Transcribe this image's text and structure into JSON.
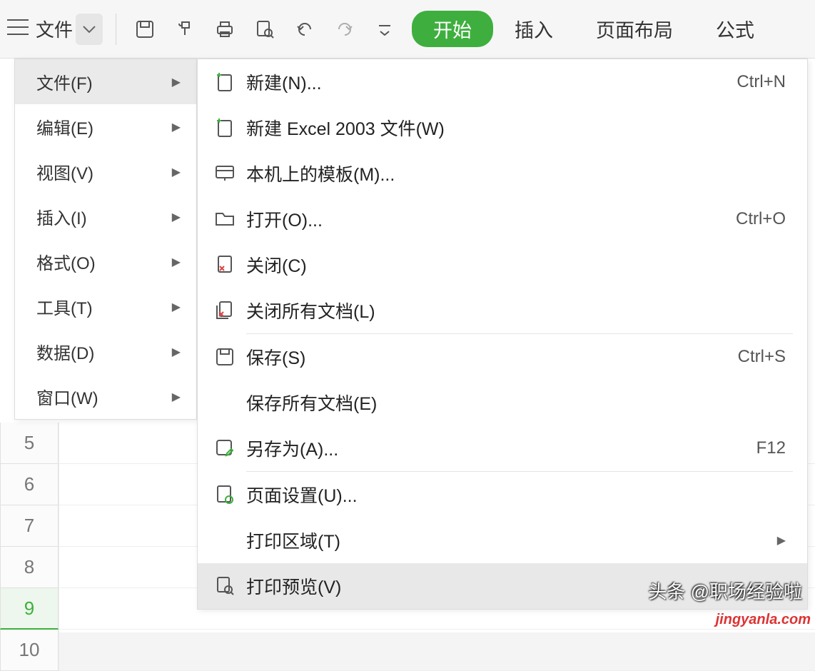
{
  "toolbar": {
    "file_label": "文件",
    "tabs": {
      "start": "开始",
      "insert": "插入",
      "page_layout": "页面布局",
      "formula": "公式"
    }
  },
  "left_menu": [
    {
      "label": "文件(F)"
    },
    {
      "label": "编辑(E)"
    },
    {
      "label": "视图(V)"
    },
    {
      "label": "插入(I)"
    },
    {
      "label": "格式(O)"
    },
    {
      "label": "工具(T)"
    },
    {
      "label": "数据(D)"
    },
    {
      "label": "窗口(W)"
    }
  ],
  "right_menu": {
    "new": {
      "label": "新建(N)...",
      "shortcut": "Ctrl+N"
    },
    "new_excel2003": {
      "label": "新建 Excel 2003 文件(W)"
    },
    "templates": {
      "label": "本机上的模板(M)..."
    },
    "open": {
      "label": "打开(O)...",
      "shortcut": "Ctrl+O"
    },
    "close": {
      "label": "关闭(C)"
    },
    "close_all": {
      "label": "关闭所有文档(L)"
    },
    "save": {
      "label": "保存(S)",
      "shortcut": "Ctrl+S"
    },
    "save_all": {
      "label": "保存所有文档(E)"
    },
    "save_as": {
      "label": "另存为(A)...",
      "shortcut": "F12"
    },
    "page_setup": {
      "label": "页面设置(U)..."
    },
    "print_area": {
      "label": "打印区域(T)"
    },
    "print_preview": {
      "label": "打印预览(V)"
    }
  },
  "rows": [
    "5",
    "6",
    "7",
    "8",
    "9",
    "10"
  ],
  "watermark": {
    "line1": "头条 @职场经验啦",
    "line2": "jingyanla.com"
  }
}
